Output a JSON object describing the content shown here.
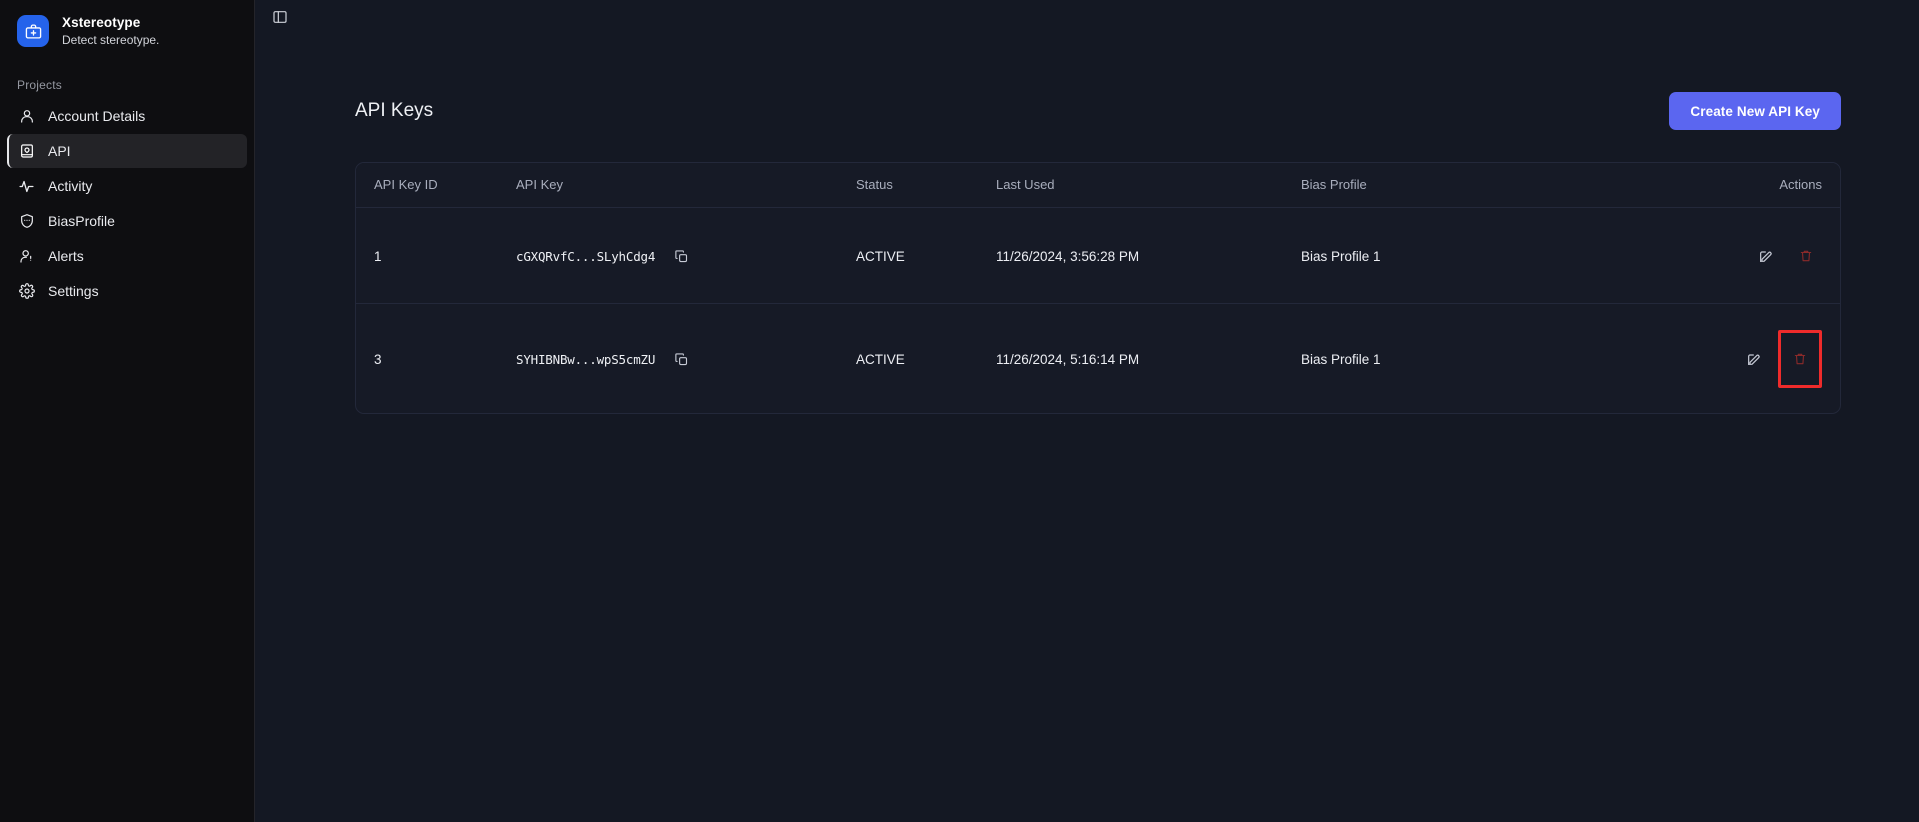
{
  "app": {
    "brand_name": "Xstereotype",
    "brand_tagline": "Detect stereotype.",
    "logo_icon": "briefcase-medical-icon",
    "logo_color": "#2563eb",
    "panel_toggle_icon": "sidebar-toggle-icon"
  },
  "sidebar": {
    "section_label": "Projects",
    "items": [
      {
        "label": "Account Details",
        "icon": "user-icon",
        "active": false
      },
      {
        "label": "API",
        "icon": "api-book-icon",
        "active": true
      },
      {
        "label": "Activity",
        "icon": "activity-pulse-icon",
        "active": false
      },
      {
        "label": "BiasProfile",
        "icon": "shield-dots-icon",
        "active": false
      },
      {
        "label": "Alerts",
        "icon": "user-alert-icon",
        "active": false
      },
      {
        "label": "Settings",
        "icon": "gear-icon",
        "active": false
      }
    ]
  },
  "main": {
    "page_title": "API Keys",
    "create_button_label": "Create New API Key",
    "accent_color": "#5b66f0"
  },
  "table": {
    "columns": [
      "API Key ID",
      "API Key",
      "Status",
      "Last Used",
      "Bias Profile",
      "Actions"
    ],
    "rows": [
      {
        "id": "1",
        "api_key": "cGXQRvfC...SLyhCdg4",
        "status": "ACTIVE",
        "last_used": "11/26/2024, 3:56:28 PM",
        "bias_profile": "Bias Profile 1",
        "copy_icon": "copy-icon",
        "edit_icon": "edit-pencil-icon",
        "delete_icon": "trash-icon",
        "delete_highlighted": false
      },
      {
        "id": "3",
        "api_key": "SYHIBNBw...wpS5cmZU",
        "status": "ACTIVE",
        "last_used": "11/26/2024, 5:16:14 PM",
        "bias_profile": "Bias Profile 1",
        "copy_icon": "copy-icon",
        "edit_icon": "edit-pencil-icon",
        "delete_icon": "trash-icon",
        "delete_highlighted": true
      }
    ],
    "highlight_color": "#ef2b2b"
  }
}
